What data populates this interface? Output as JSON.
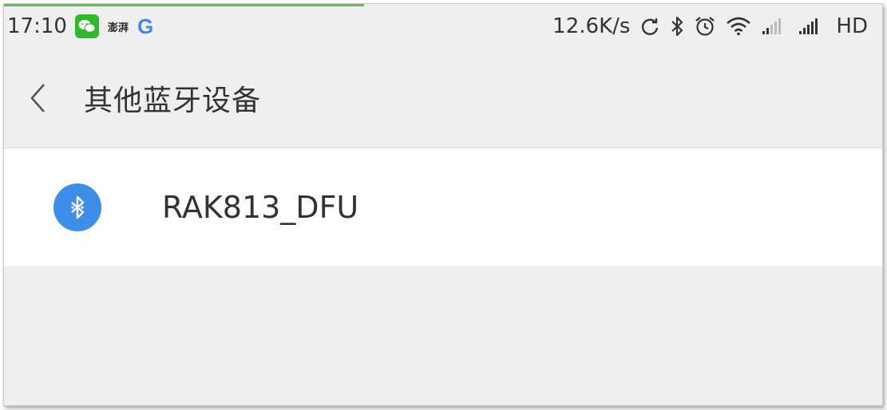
{
  "status_bar": {
    "time": "17:10",
    "notification_icons": [
      "wechat-icon",
      "news-app-icon",
      "google-icon"
    ],
    "news_app_text": "澎湃",
    "google_letter": "G",
    "net_speed": "12.6K/s",
    "network_label": "HD",
    "icons": [
      "sync-icon",
      "bluetooth-icon",
      "alarm-icon",
      "wifi-icon",
      "signal-weak-icon",
      "signal-strong-icon"
    ],
    "load_progress": 0.41
  },
  "header": {
    "title": "其他蓝牙设备",
    "back_icon": "chevron-left-icon"
  },
  "devices": [
    {
      "name": "RAK813_DFU",
      "icon": "bluetooth-icon"
    }
  ],
  "colors": {
    "progress": "#5ec24a",
    "bluetooth_badge": "#3d8ee8",
    "wechat": "#2fb92f",
    "google_blue": "#4285f4",
    "background": "#efefef",
    "row_background": "#ffffff"
  }
}
